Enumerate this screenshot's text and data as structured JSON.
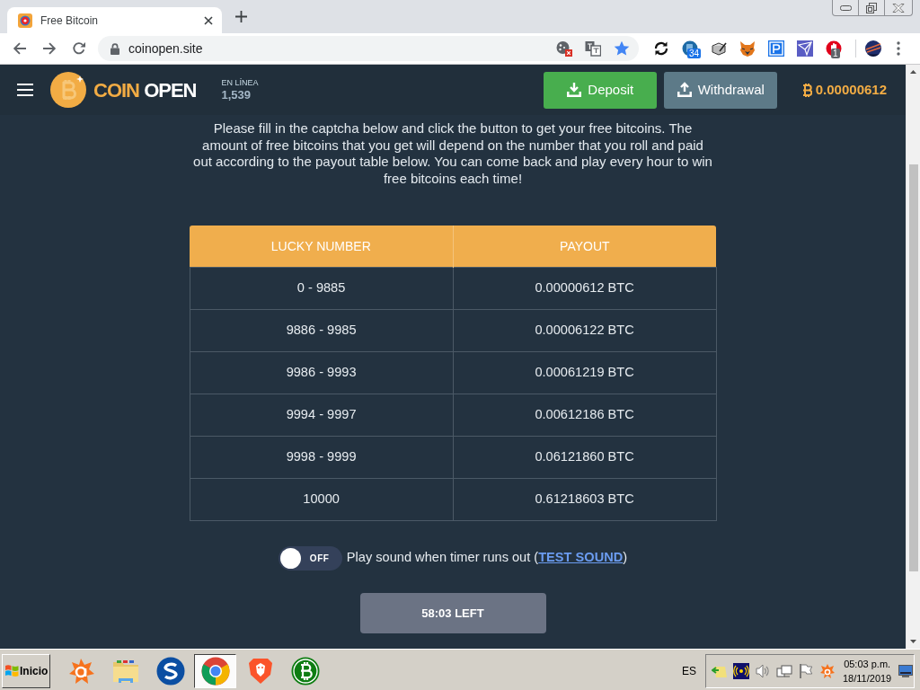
{
  "browser": {
    "tab": {
      "title": "Free Bitcoin",
      "selected": true
    },
    "address": "coinopen.site",
    "extensions": [
      {
        "kind": "sync"
      },
      {
        "kind": "disc",
        "badge": "34"
      },
      {
        "kind": "pen"
      },
      {
        "kind": "fox"
      },
      {
        "kind": "parking"
      },
      {
        "kind": "plane"
      },
      {
        "kind": "hand",
        "badge": "1"
      },
      {
        "kind": "avatar"
      }
    ]
  },
  "site_header": {
    "logo": [
      "COIN",
      "OPEN"
    ],
    "online_label": "EN LÍNEA",
    "online_count": "1,539",
    "actions": [
      {
        "kind": "deposit",
        "label": "Deposit"
      },
      {
        "kind": "withdraw",
        "label": "Withdrawal"
      }
    ],
    "balance": "0.00000612"
  },
  "intro": "Please fill in the captcha below and click the button to get your free bitcoins. The amount of free bitcoins that you get will depend on the number that you roll and paid out according to the payout table below. You can come back and play every hour to win free bitcoins each time!",
  "payout_table": {
    "columns": [
      "LUCKY NUMBER",
      "PAYOUT"
    ],
    "rows": [
      [
        "0 - 9885",
        "0.00000612 BTC"
      ],
      [
        "9886 - 9985",
        "0.00006122 BTC"
      ],
      [
        "9986 - 9993",
        "0.00061219 BTC"
      ],
      [
        "9994 - 9997",
        "0.00612186 BTC"
      ],
      [
        "9998 - 9999",
        "0.06121860 BTC"
      ],
      [
        "10000",
        "0.61218603 BTC"
      ]
    ]
  },
  "sound_toggle": {
    "on": false,
    "state_label": "OFF",
    "text_before": "Play sound when timer runs out (",
    "link": "TEST SOUND",
    "text_after": ")"
  },
  "timer_button": {
    "label": "58:03 LEFT"
  },
  "taskbar": {
    "start": "Inicio",
    "apps": [
      {
        "kind": "splat",
        "selected": false
      },
      {
        "kind": "folder",
        "selected": false
      },
      {
        "kind": "swirl",
        "selected": false
      },
      {
        "kind": "ring",
        "selected": true
      },
      {
        "kind": "lion",
        "selected": false
      },
      {
        "kind": "coin",
        "selected": false
      }
    ],
    "language": "ES",
    "clock": {
      "time": "05:03 p.m.",
      "date": "18/11/2019"
    }
  }
}
